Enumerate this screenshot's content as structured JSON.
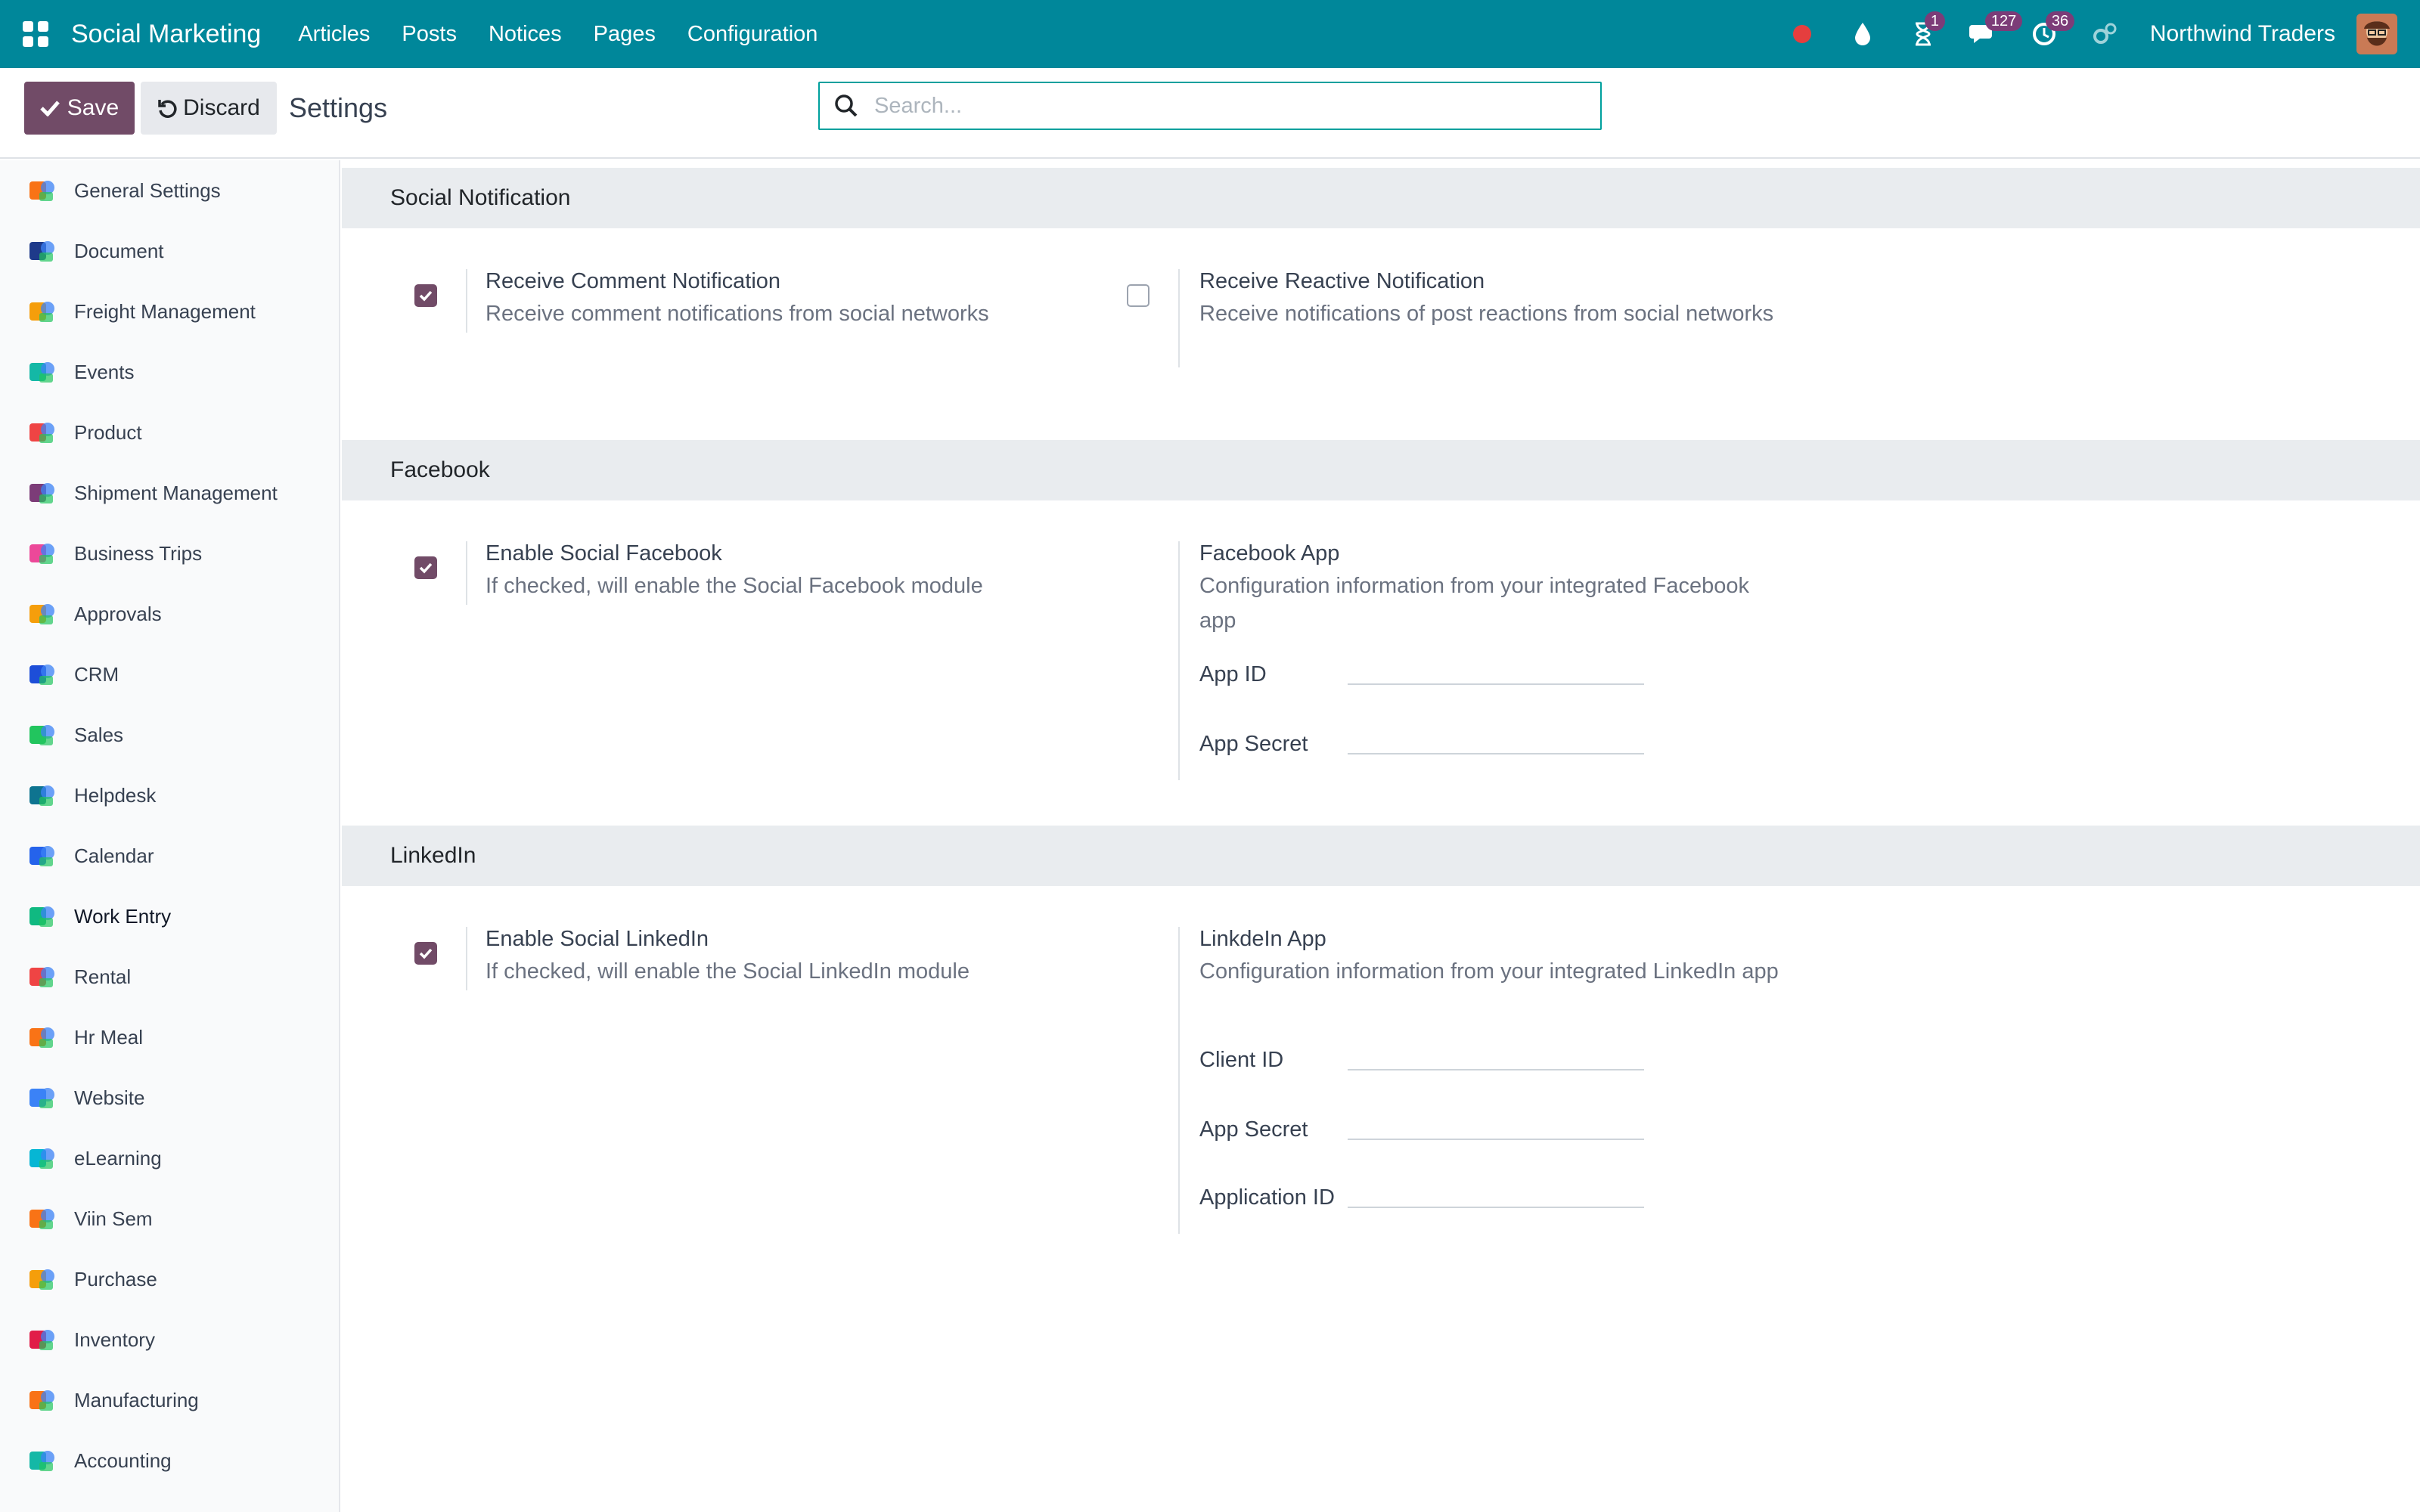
{
  "app": {
    "brand": "Social Marketing",
    "menu": [
      "Articles",
      "Posts",
      "Notices",
      "Pages",
      "Configuration"
    ],
    "company": "Northwind Traders",
    "badges": {
      "activities": "1",
      "messages": "127",
      "clock": "36"
    }
  },
  "controlpanel": {
    "save_label": "Save",
    "discard_label": "Discard",
    "title": "Settings",
    "search_placeholder": "Search..."
  },
  "sidebar": {
    "items": [
      {
        "label": "General Settings",
        "icon": "general-settings-icon",
        "color": "#f97316"
      },
      {
        "label": "Document",
        "icon": "document-icon",
        "color": "#1e3a8a"
      },
      {
        "label": "Freight Management",
        "icon": "freight-icon",
        "color": "#f59e0b"
      },
      {
        "label": "Events",
        "icon": "events-icon",
        "color": "#14b8a6"
      },
      {
        "label": "Product",
        "icon": "product-icon",
        "color": "#ef4444"
      },
      {
        "label": "Shipment Management",
        "icon": "shipment-icon",
        "color": "#7c3c78"
      },
      {
        "label": "Business Trips",
        "icon": "business-trips-icon",
        "color": "#ec4899"
      },
      {
        "label": "Approvals",
        "icon": "approvals-icon",
        "color": "#f59e0b"
      },
      {
        "label": "CRM",
        "icon": "crm-icon",
        "color": "#1d4ed8"
      },
      {
        "label": "Sales",
        "icon": "sales-icon",
        "color": "#22c55e"
      },
      {
        "label": "Helpdesk",
        "icon": "helpdesk-icon",
        "color": "#0e7490"
      },
      {
        "label": "Calendar",
        "icon": "calendar-icon",
        "color": "#2563eb"
      },
      {
        "label": "Work Entry",
        "icon": "work-entry-icon",
        "color": "#10b981"
      },
      {
        "label": "Rental",
        "icon": "rental-icon",
        "color": "#ef4444"
      },
      {
        "label": "Hr Meal",
        "icon": "hr-meal-icon",
        "color": "#f97316"
      },
      {
        "label": "Website",
        "icon": "website-icon",
        "color": "#3b82f6"
      },
      {
        "label": "eLearning",
        "icon": "elearning-icon",
        "color": "#06b6d4"
      },
      {
        "label": "Viin Sem",
        "icon": "viin-sem-icon",
        "color": "#f97316"
      },
      {
        "label": "Purchase",
        "icon": "purchase-icon",
        "color": "#f59e0b"
      },
      {
        "label": "Inventory",
        "icon": "inventory-icon",
        "color": "#e11d48"
      },
      {
        "label": "Manufacturing",
        "icon": "manufacturing-icon",
        "color": "#f97316"
      },
      {
        "label": "Accounting",
        "icon": "accounting-icon",
        "color": "#14b8a6"
      }
    ]
  },
  "sections": {
    "social_notification": {
      "title": "Social Notification",
      "comment": {
        "title": "Receive Comment Notification",
        "desc": "Receive comment notifications from social networks",
        "checked": true
      },
      "reactive": {
        "title": "Receive Reactive Notification",
        "desc": "Receive notifications of post reactions from social networks",
        "checked": false
      }
    },
    "facebook": {
      "title": "Facebook",
      "enable": {
        "title": "Enable Social Facebook",
        "desc": "If checked, will enable the Social Facebook module",
        "checked": true
      },
      "app": {
        "title": "Facebook App",
        "desc": "Configuration information from your integrated Facebook app"
      },
      "fields": [
        {
          "label": "App ID",
          "value": ""
        },
        {
          "label": "App Secret",
          "value": ""
        }
      ]
    },
    "linkedin": {
      "title": "LinkedIn",
      "enable": {
        "title": "Enable Social LinkedIn",
        "desc": "If checked, will enable the Social LinkedIn module",
        "checked": true
      },
      "app": {
        "title": "LinkdeIn App",
        "desc": "Configuration information from your integrated LinkedIn app"
      },
      "fields": [
        {
          "label": "Client ID",
          "value": ""
        },
        {
          "label": "App Secret",
          "value": ""
        },
        {
          "label": "Application ID",
          "value": ""
        }
      ]
    }
  }
}
